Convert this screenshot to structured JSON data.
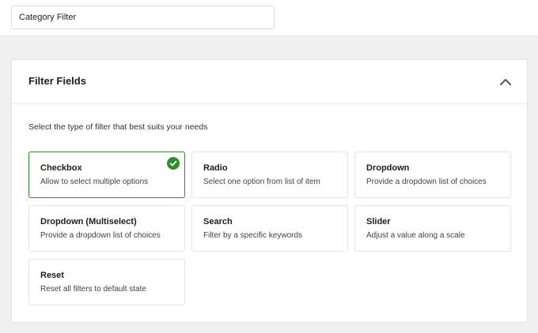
{
  "header": {
    "title_value": "Category Filter"
  },
  "panel": {
    "title": "Filter Fields",
    "description": "Select the type of filter that best suits your needs",
    "cards": [
      {
        "title": "Checkbox",
        "description": "Allow to select multiple options",
        "selected": true
      },
      {
        "title": "Radio",
        "description": "Select one option from list of item",
        "selected": false
      },
      {
        "title": "Dropdown",
        "description": "Provide a dropdown list of choices",
        "selected": false
      },
      {
        "title": "Dropdown (Multiselect)",
        "description": "Provide a dropdown list of choices",
        "selected": false
      },
      {
        "title": "Search",
        "description": "Filter by a specific keywords",
        "selected": false
      },
      {
        "title": "Slider",
        "description": "Adjust a value along a scale",
        "selected": false
      },
      {
        "title": "Reset",
        "description": "Reset all filters to default state",
        "selected": false
      }
    ]
  },
  "colors": {
    "accent": "#2e8b2e",
    "background": "#f0f0f1"
  },
  "icons": {
    "collapse": "chevron-up-icon",
    "selected": "check-circle-icon"
  }
}
